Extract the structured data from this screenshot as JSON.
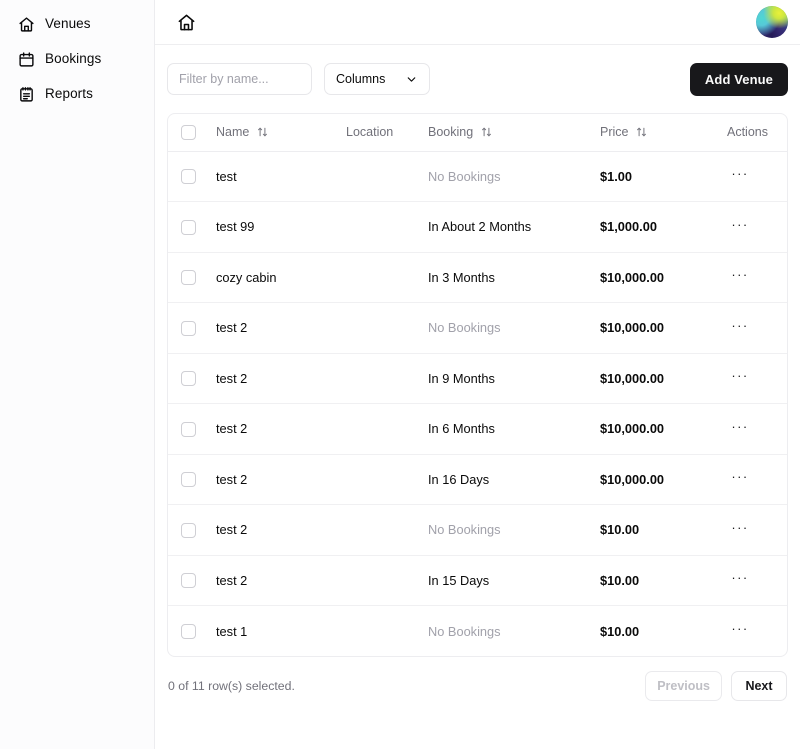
{
  "sidebar": {
    "items": [
      {
        "label": "Venues",
        "icon": "home-icon"
      },
      {
        "label": "Bookings",
        "icon": "calendar-icon"
      },
      {
        "label": "Reports",
        "icon": "clipboard-icon"
      }
    ]
  },
  "topbar": {
    "home_icon": "home-icon",
    "avatar": "user-avatar"
  },
  "toolbar": {
    "filter_placeholder": "Filter by name...",
    "filter_value": "",
    "columns_label": "Columns",
    "add_label": "Add Venue"
  },
  "table": {
    "columns": [
      {
        "key": "select",
        "label": "",
        "sortable": false
      },
      {
        "key": "name",
        "label": "Name",
        "sortable": true
      },
      {
        "key": "location",
        "label": "Location",
        "sortable": false
      },
      {
        "key": "booking",
        "label": "Booking",
        "sortable": true
      },
      {
        "key": "price",
        "label": "Price",
        "sortable": true
      },
      {
        "key": "actions",
        "label": "Actions",
        "sortable": false
      }
    ],
    "rows": [
      {
        "name": "test",
        "location": "",
        "booking": "No Bookings",
        "booking_empty": true,
        "price": "$1.00",
        "selected": false
      },
      {
        "name": "test 99",
        "location": "",
        "booking": "In About 2 Months",
        "booking_empty": false,
        "price": "$1,000.00",
        "selected": false
      },
      {
        "name": "cozy cabin",
        "location": "",
        "booking": "In 3 Months",
        "booking_empty": false,
        "price": "$10,000.00",
        "selected": false
      },
      {
        "name": "test 2",
        "location": "",
        "booking": "No Bookings",
        "booking_empty": true,
        "price": "$10,000.00",
        "selected": false
      },
      {
        "name": "test 2",
        "location": "",
        "booking": "In 9 Months",
        "booking_empty": false,
        "price": "$10,000.00",
        "selected": false
      },
      {
        "name": "test 2",
        "location": "",
        "booking": "In 6 Months",
        "booking_empty": false,
        "price": "$10,000.00",
        "selected": false
      },
      {
        "name": "test 2",
        "location": "",
        "booking": "In 16 Days",
        "booking_empty": false,
        "price": "$10,000.00",
        "selected": false
      },
      {
        "name": "test 2",
        "location": "",
        "booking": "No Bookings",
        "booking_empty": true,
        "price": "$10.00",
        "selected": false
      },
      {
        "name": "test 2",
        "location": "",
        "booking": "In 15 Days",
        "booking_empty": false,
        "price": "$10.00",
        "selected": false
      },
      {
        "name": "test 1",
        "location": "",
        "booking": "No Bookings",
        "booking_empty": true,
        "price": "$10.00",
        "selected": false
      }
    ],
    "row_action_label": "···"
  },
  "footer": {
    "rows_selected": "0 of 11 row(s) selected.",
    "previous_label": "Previous",
    "next_label": "Next",
    "previous_disabled": true
  },
  "colors": {
    "accent": "#18181b",
    "muted_text": "#71717a",
    "empty_text": "#a1a1aa",
    "border": "#ededf0"
  }
}
